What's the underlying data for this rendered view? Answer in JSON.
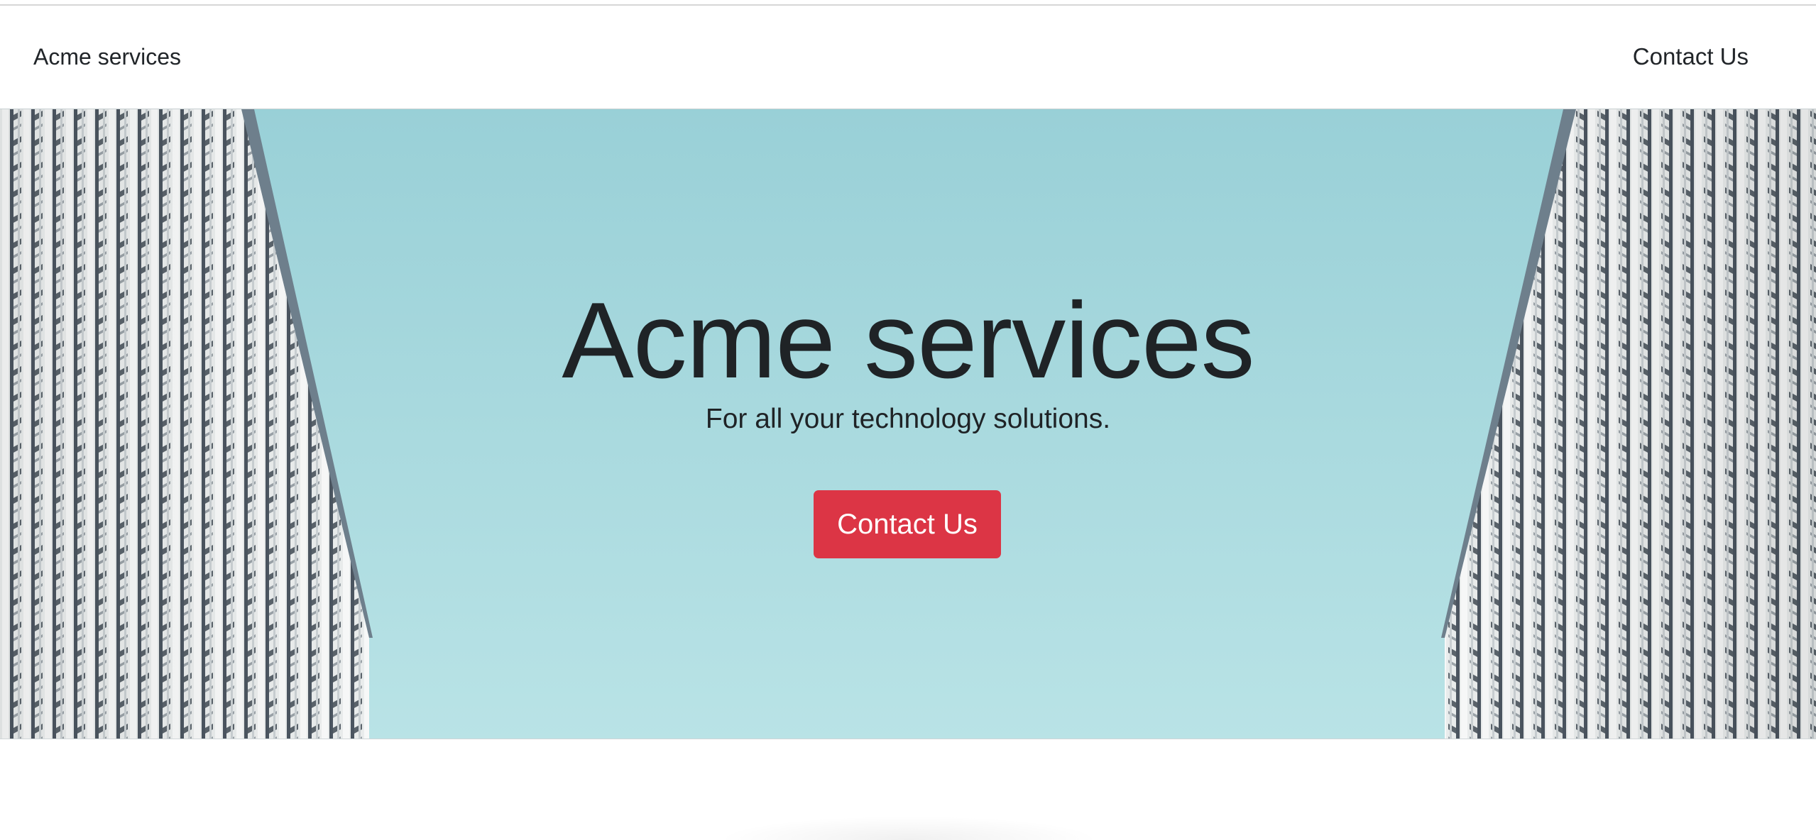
{
  "navbar": {
    "brand": "Acme services",
    "contact_link": "Contact Us"
  },
  "hero": {
    "title": "Acme services",
    "subtitle": "For all your technology solutions.",
    "cta_label": "Contact Us",
    "cta_color": "#dc3545",
    "background": "sky between two buildings"
  },
  "colors": {
    "sky_top": "#98d1d8",
    "sky_bottom": "#b8e3e6",
    "text": "#212529"
  }
}
